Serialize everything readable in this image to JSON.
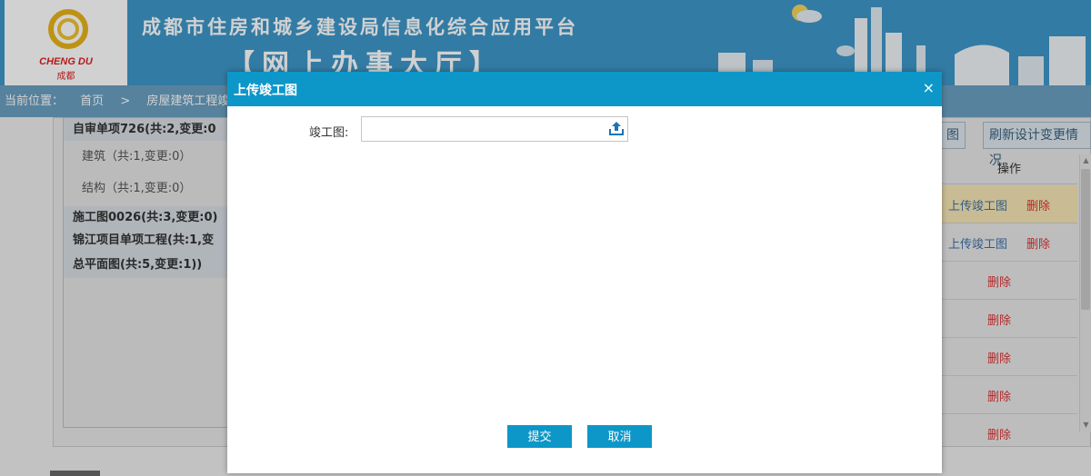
{
  "header": {
    "logo_en": "CHENG DU",
    "logo_cn": "成都",
    "title": "成都市住房和城乡建设局信息化综合应用平台",
    "subtitle": "【网上办事大厅】"
  },
  "breadcrumb": {
    "label": "当前位置：",
    "home": "首页",
    "separator": ">",
    "current": "房屋建筑工程竣工"
  },
  "tree": {
    "items": [
      "自审单项726(共:2,变更:0",
      "建筑（共:1,变更:0）",
      "结构（共:1,变更:0）",
      "施工图0026(共:3,变更:0)",
      "锦江项目单项工程(共:1,变",
      "总平面图(共:5,变更:1))"
    ]
  },
  "toolbar": {
    "btn_partial": "图",
    "btn_refresh": "刷新设计变更情况"
  },
  "table": {
    "header": "操作",
    "upload_link": "上传竣工图",
    "delete_link": "删除"
  },
  "modal": {
    "title": "上传竣工图",
    "close": "×",
    "field_label": "竣工图:",
    "file_value": "",
    "submit": "提交",
    "cancel": "取消"
  },
  "colors": {
    "header_bg": "#3d97c8",
    "modal_head": "#0d97c8",
    "delete_red": "#d33",
    "link_blue": "#3e6fa5"
  }
}
